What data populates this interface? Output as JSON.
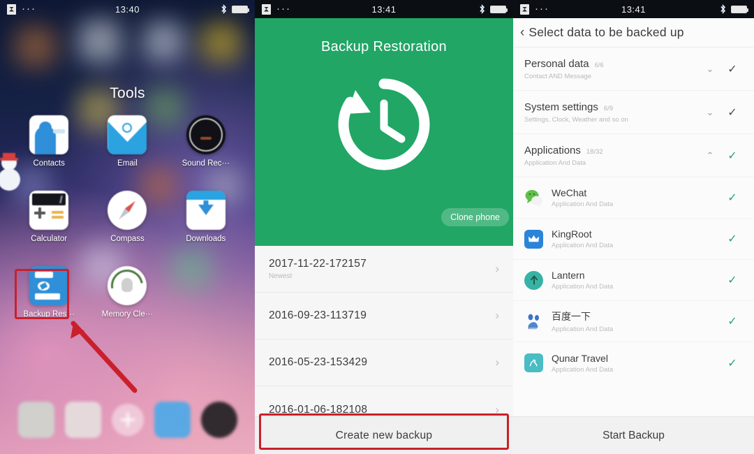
{
  "panels": {
    "home": {
      "status": {
        "time": "13:40",
        "dots": "···",
        "app_icon": "app-badge-icon",
        "bluetooth": "bluetooth-icon",
        "battery": "battery-icon"
      },
      "folder_title": "Tools",
      "apps": [
        {
          "label": "Contacts",
          "icon": "contacts-icon"
        },
        {
          "label": "Email",
          "icon": "email-icon"
        },
        {
          "label": "Sound Rec···",
          "icon": "sound-recorder-icon"
        },
        {
          "label": "Calculator",
          "icon": "calculator-icon"
        },
        {
          "label": "Compass",
          "icon": "compass-icon"
        },
        {
          "label": "Downloads",
          "icon": "downloads-icon"
        },
        {
          "label": "Backup Res···",
          "icon": "backup-restore-icon"
        },
        {
          "label": "Memory Cle···",
          "icon": "memory-cleaner-icon"
        }
      ],
      "annotation": {
        "highlight_color": "#c9202c",
        "highlight_target": "Backup Res···"
      }
    },
    "restoration": {
      "status": {
        "time": "13:41"
      },
      "hero_title": "Backup Restoration",
      "hero_color": "#21a665",
      "hero_icon": "restore-clock-icon",
      "clone_chip": "Clone phone",
      "backups": [
        {
          "name": "2017-11-22-172157",
          "sub": "Newest"
        },
        {
          "name": "2016-09-23-113719",
          "sub": ""
        },
        {
          "name": "2016-05-23-153429",
          "sub": ""
        },
        {
          "name": "2016-01-06-182108",
          "sub": ""
        }
      ],
      "chevron": "›",
      "cta_label": "Create new backup",
      "cta_highlight_color": "#c9202c"
    },
    "select_data": {
      "status": {
        "time": "13:41"
      },
      "back_icon": "chevron-left-icon",
      "title": "Select data to be backed up",
      "categories": [
        {
          "title": "Personal data",
          "count": "6/6",
          "sub": "Contact AND Message",
          "expand": "chevron-down-icon",
          "expanded": false,
          "checked": true
        },
        {
          "title": "System settings",
          "count": "6/9",
          "sub": "Settings, Clock, Weather and so on",
          "expand": "chevron-down-icon",
          "expanded": false,
          "checked": true
        },
        {
          "title": "Applications",
          "count": "18/32",
          "sub": "Application And Data",
          "expand": "chevron-up-icon",
          "expanded": true,
          "checked": true
        }
      ],
      "apps": [
        {
          "name": "WeChat",
          "sub": "Application And Data",
          "icon": "wechat-icon",
          "checked": true
        },
        {
          "name": "KingRoot",
          "sub": "Application And Data",
          "icon": "kingroot-icon",
          "checked": true
        },
        {
          "name": "Lantern",
          "sub": "Application And Data",
          "icon": "lantern-icon",
          "checked": true
        },
        {
          "name": "百度一下",
          "sub": "Application And Data",
          "icon": "baidu-icon",
          "checked": true
        },
        {
          "name": "Qunar Travel",
          "sub": "Application And Data",
          "icon": "qunar-icon",
          "checked": true
        }
      ],
      "check_glyph": "✓",
      "cta_label": "Start Backup",
      "accent_color": "#2e9e6b"
    }
  }
}
